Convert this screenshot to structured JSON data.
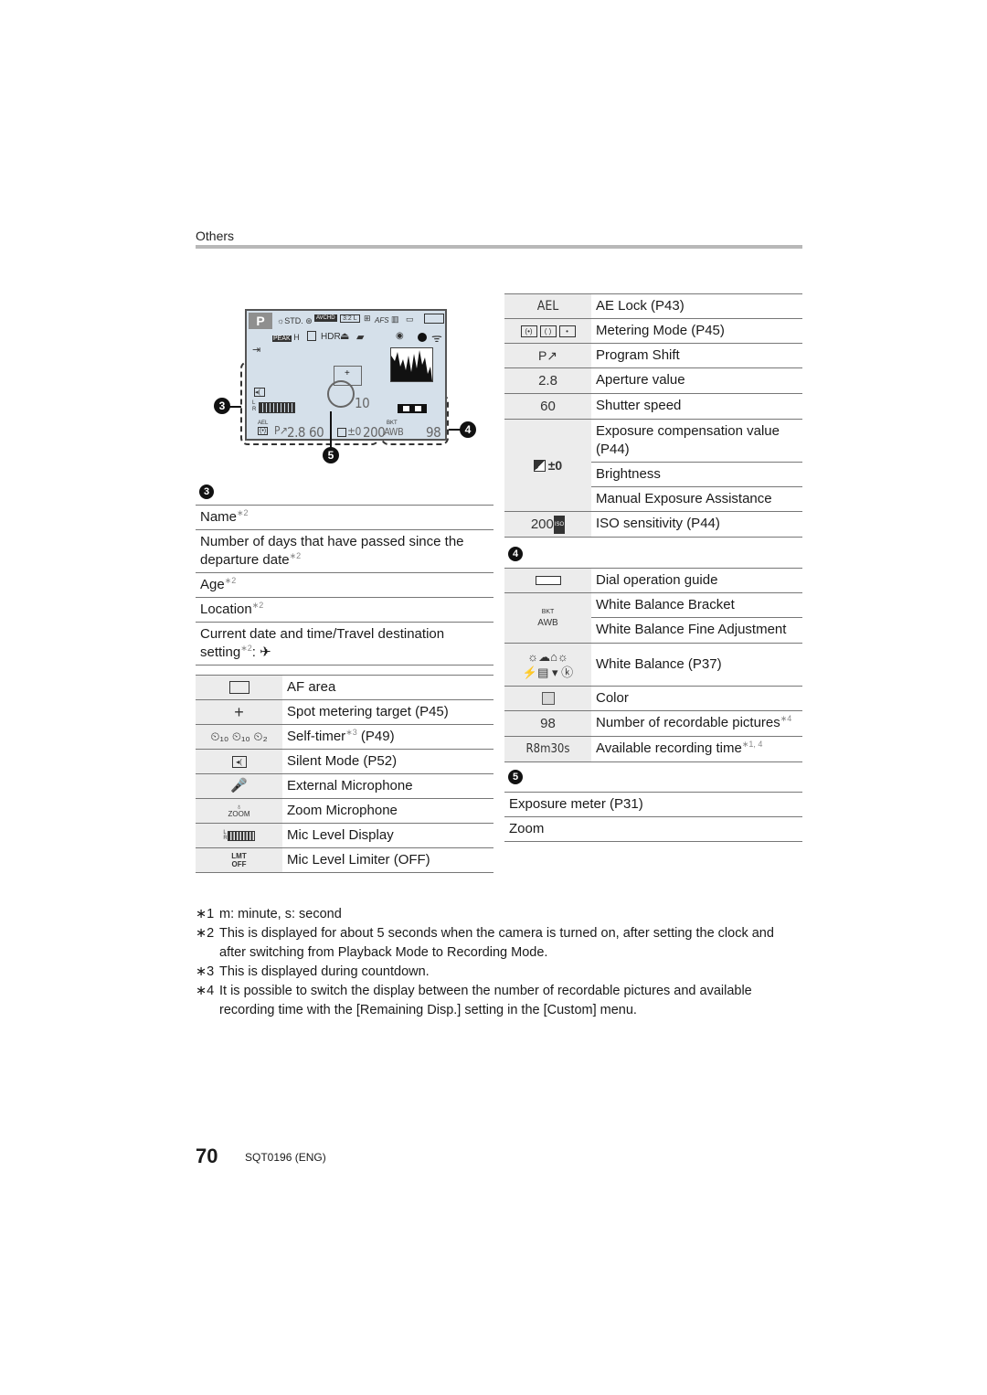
{
  "header": {
    "section": "Others"
  },
  "lcd": {
    "mode": "P",
    "photo_style": "STD.",
    "peak": "PEAK",
    "peak_level": "H",
    "hdr": "HDR",
    "aspect": "3:2",
    "size": "L",
    "afs": "AFS",
    "timer_value": "10",
    "aperture": "2.8",
    "shutter": "60",
    "exposure": "±0",
    "iso": "200",
    "ael": "AEL",
    "bkt": "BKT",
    "awb": "AWB",
    "remaining": "98"
  },
  "callouts": {
    "c3": "3",
    "c4": "4",
    "c5": "5"
  },
  "section3": {
    "badge": "3",
    "rows": [
      {
        "text": "Name",
        "sup": "∗2"
      },
      {
        "text": "Number of days that have passed since the departure date",
        "sup": "∗2"
      },
      {
        "text": "Age",
        "sup": "∗2"
      },
      {
        "text": "Location",
        "sup": "∗2"
      },
      {
        "text": "Current date and time/Travel destination setting",
        "sup": "∗2",
        "suffix": ": ✈"
      }
    ],
    "icon_rows": [
      {
        "icon": "af-area-icon",
        "label": "AF area"
      },
      {
        "icon": "spot-target-icon",
        "symbol": "+",
        "label": "Spot metering target (P45)"
      },
      {
        "icon": "self-timer-icon",
        "label": "Self-timer",
        "sup": "∗3",
        "suffix": " (P49)"
      },
      {
        "icon": "silent-mode-icon",
        "label": "Silent Mode (P52)"
      },
      {
        "icon": "external-mic-icon",
        "label": "External Microphone"
      },
      {
        "icon": "zoom-mic-icon",
        "label": "Zoom Microphone"
      },
      {
        "icon": "mic-level-icon",
        "label": "Mic Level Display"
      },
      {
        "icon": "mic-limiter-icon",
        "symbol": "LMT OFF",
        "label": "Mic Level Limiter (OFF)"
      }
    ]
  },
  "right_table": [
    {
      "symbol": "AEL",
      "label": "AE Lock (P43)"
    },
    {
      "symbol": "metering",
      "label": "Metering Mode (P45)"
    },
    {
      "symbol": "P↗",
      "label": "Program Shift"
    },
    {
      "symbol": "2.8",
      "label": "Aperture value"
    },
    {
      "symbol": "60",
      "label": "Shutter speed"
    },
    {
      "symbol": "±0",
      "labels": [
        "Exposure compensation value (P44)",
        "Brightness",
        "Manual Exposure Assistance"
      ]
    },
    {
      "symbol": "200",
      "symbol_sup": "ISO",
      "label": "ISO sensitivity (P44)"
    }
  ],
  "section4": {
    "badge": "4",
    "rows": [
      {
        "symbol": "dial-guide",
        "label": "Dial operation guide"
      },
      {
        "symbol_top": "BKT",
        "symbol": "AWB",
        "labels": [
          "White Balance Bracket",
          "White Balance Fine Adjustment"
        ]
      },
      {
        "symbol": "wb-icons",
        "label": "White Balance (P37)"
      },
      {
        "symbol": "color-square",
        "label": "Color"
      },
      {
        "symbol": "98",
        "label": "Number of recordable pictures",
        "sup": "∗4"
      },
      {
        "symbol": "R8m30s",
        "label": "Available recording time",
        "sup": "∗1, 4"
      }
    ]
  },
  "section5": {
    "badge": "5",
    "rows": [
      {
        "label": "Exposure meter (P31)"
      },
      {
        "label": "Zoom"
      }
    ]
  },
  "notes": [
    {
      "mark": "∗1",
      "text": "m: minute, s: second"
    },
    {
      "mark": "∗2",
      "text": "This is displayed for about 5 seconds when the camera is turned on, after setting the clock and after switching from Playback Mode to Recording Mode."
    },
    {
      "mark": "∗3",
      "text": "This is displayed during countdown."
    },
    {
      "mark": "∗4",
      "text": "It is possible to switch the display between the number of recordable pictures and available recording time with the [Remaining Disp.] setting in the [Custom] menu."
    }
  ],
  "footer": {
    "page": "70",
    "code": "SQT0196 (ENG)"
  }
}
